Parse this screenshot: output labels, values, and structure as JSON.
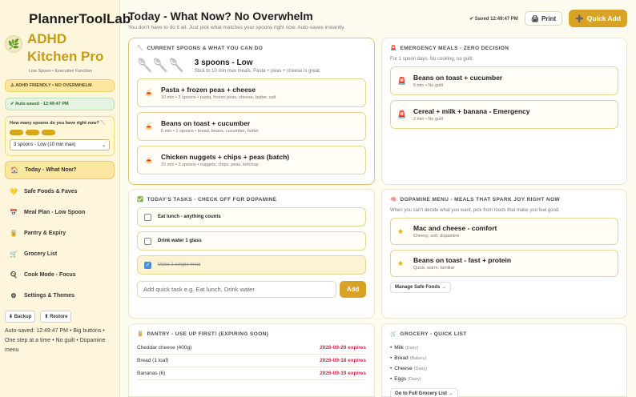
{
  "app": {
    "title": "PlannerToolLab",
    "brand_name": "ADHD Kitchen Pro",
    "brand_sub": "Low Spoon • Executive Function",
    "logo_icon": "leaf-logo-icon"
  },
  "sidebar": {
    "badge_friendly": "⚠ ADHD FRIENDLY • NO OVERWHELM",
    "badge_autosaved": "✔ Auto-saved - 12:49:47 PM",
    "spoon_question": "How many spoons do you have right now? 🥄",
    "spoon_select_value": "3 spoons - Low (10 min max)",
    "nav": [
      {
        "label": "Today - What Now?",
        "icon": "🏠",
        "active": true
      },
      {
        "label": "Safe Foods & Faves",
        "icon": "💛",
        "active": false
      },
      {
        "label": "Meal Plan - Low Spoon",
        "icon": "📅",
        "active": false
      },
      {
        "label": "Pantry & Expiry",
        "icon": "🥫",
        "active": false
      },
      {
        "label": "Grocery List",
        "icon": "🛒",
        "active": false
      },
      {
        "label": "Cook Mode - Focus",
        "icon": "🍳",
        "active": false
      },
      {
        "label": "Settings & Themes",
        "icon": "⚙",
        "active": false
      }
    ],
    "backup_label": "⬇ Backup",
    "restore_label": "⬆ Restore",
    "footer_note": "Auto-saved: 12:49:47 PM • Big buttons • One step at a time • No guilt • Dopamine menu"
  },
  "header": {
    "title": "Today - What Now? No Overwhelm",
    "subtitle": "You don't have to do it all. Just pick what matches your spoons right now. Auto-saves instantly.",
    "saved_text": "✔ Saved 12:49:47 PM",
    "print_label": "Print",
    "quick_add_label": "Quick Add"
  },
  "spoons_card": {
    "title": "Current spoons & what you can do",
    "count_label": "3 spoons - Low",
    "hint": "Stick to 10 min max meals. Pasta + peas + cheese is great.",
    "meals": [
      {
        "name": "Pasta + frozen peas + cheese",
        "meta": "10 min • 3 spoons • pasta, frozen peas, cheese, butter, salt"
      },
      {
        "name": "Beans on toast + cucumber",
        "meta": "5 min • 1 spoons • bread, beans, cucumber, butter"
      },
      {
        "name": "Chicken nuggets + chips + peas (batch)",
        "meta": "15 min • 3 spoons • nuggets, chips, peas, ketchup"
      }
    ]
  },
  "emergency_card": {
    "title": "Emergency meals - zero decision",
    "desc": "For 1 spoon days. No cooking, no guilt.",
    "items": [
      {
        "name": "Beans on toast + cucumber",
        "meta": "5 min • No guilt"
      },
      {
        "name": "Cereal + milk + banana - Emergency",
        "meta": "2 min • No guilt"
      }
    ]
  },
  "tasks_card": {
    "title": "Today's tasks - check off for dopamine",
    "tasks": [
      {
        "label": "Eat lunch - anything counts",
        "done": false
      },
      {
        "label": "Drink water 1 glass",
        "done": false
      },
      {
        "label": "Make 1 simple meal",
        "done": true
      }
    ],
    "input_placeholder": "Add quick task e.g. Eat lunch, Drink water",
    "add_label": "Add"
  },
  "dopamine_card": {
    "title": "Dopamine menu - meals that spark joy right now",
    "desc": "When you can't decide what you want, pick from foods that make you feel good.",
    "items": [
      {
        "name": "Mac and cheese - comfort",
        "meta": "Cheesy, soft, dopamine"
      },
      {
        "name": "Beans on toast - fast + protein",
        "meta": "Quick, warm, familiar"
      }
    ],
    "manage_label": "Manage Safe Foods →"
  },
  "pantry_card": {
    "title": "Pantry - use up first! (expiring soon)",
    "rows": [
      {
        "item": "Cheddar cheese (400g)",
        "expires": "2026-09-20 expires"
      },
      {
        "item": "Bread (1 loaf)",
        "expires": "2026-09-18 expires"
      },
      {
        "item": "Bananas (6)",
        "expires": "2026-09-19 expires"
      }
    ]
  },
  "grocery_card": {
    "title": "Grocery - quick list",
    "items": [
      {
        "name": "Milk",
        "cat": "(Dairy)"
      },
      {
        "name": "Bread",
        "cat": "(Bakery)"
      },
      {
        "name": "Cheese",
        "cat": "(Dairy)"
      },
      {
        "name": "Eggs",
        "cat": "(Dairy)"
      }
    ],
    "full_list_label": "Go to Full Grocery List →"
  },
  "colors": {
    "accent": "#d8a325",
    "brand": "#c99a14",
    "expiry": "#cf2a4d"
  }
}
